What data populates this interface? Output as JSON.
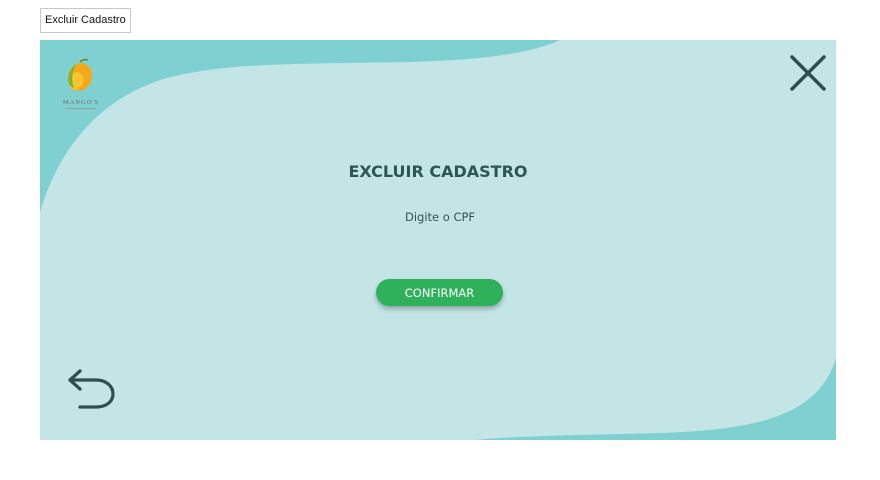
{
  "top_button": {
    "label": "Excluir Cadastro"
  },
  "logo": {
    "brand": "MANGO'S"
  },
  "dialog": {
    "title": "EXCLUIR CADASTRO",
    "cpf_placeholder": "Digite o CPF",
    "confirm_label": "CONFIRMAR"
  },
  "icons": {
    "close": "close-icon",
    "back": "back-arrow-icon",
    "logo": "mango-icon"
  },
  "colors": {
    "panel_background": "#c3e5e5",
    "wave_accent": "#7fd1d1",
    "confirm_button": "#2eb15a",
    "text_dark": "#2c5656",
    "icon_dark": "#2c4f4f"
  }
}
